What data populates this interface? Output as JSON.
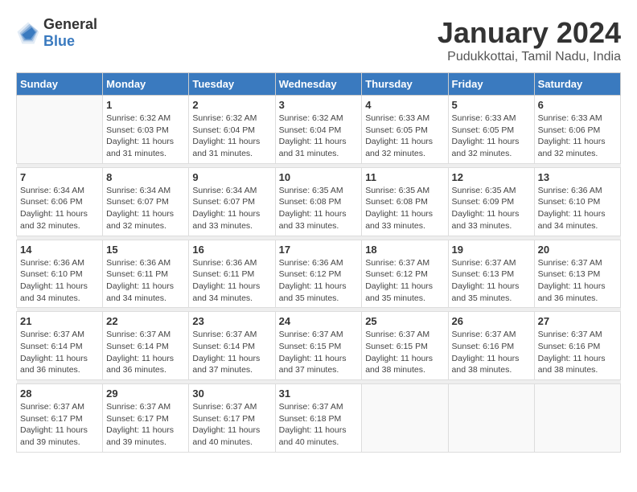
{
  "header": {
    "logo_general": "General",
    "logo_blue": "Blue",
    "title": "January 2024",
    "subtitle": "Pudukkottai, Tamil Nadu, India"
  },
  "weekdays": [
    "Sunday",
    "Monday",
    "Tuesday",
    "Wednesday",
    "Thursday",
    "Friday",
    "Saturday"
  ],
  "weeks": [
    [
      {
        "day": "",
        "info": ""
      },
      {
        "day": "1",
        "info": "Sunrise: 6:32 AM\nSunset: 6:03 PM\nDaylight: 11 hours\nand 31 minutes."
      },
      {
        "day": "2",
        "info": "Sunrise: 6:32 AM\nSunset: 6:04 PM\nDaylight: 11 hours\nand 31 minutes."
      },
      {
        "day": "3",
        "info": "Sunrise: 6:32 AM\nSunset: 6:04 PM\nDaylight: 11 hours\nand 31 minutes."
      },
      {
        "day": "4",
        "info": "Sunrise: 6:33 AM\nSunset: 6:05 PM\nDaylight: 11 hours\nand 32 minutes."
      },
      {
        "day": "5",
        "info": "Sunrise: 6:33 AM\nSunset: 6:05 PM\nDaylight: 11 hours\nand 32 minutes."
      },
      {
        "day": "6",
        "info": "Sunrise: 6:33 AM\nSunset: 6:06 PM\nDaylight: 11 hours\nand 32 minutes."
      }
    ],
    [
      {
        "day": "7",
        "info": "Sunrise: 6:34 AM\nSunset: 6:06 PM\nDaylight: 11 hours\nand 32 minutes."
      },
      {
        "day": "8",
        "info": "Sunrise: 6:34 AM\nSunset: 6:07 PM\nDaylight: 11 hours\nand 32 minutes."
      },
      {
        "day": "9",
        "info": "Sunrise: 6:34 AM\nSunset: 6:07 PM\nDaylight: 11 hours\nand 33 minutes."
      },
      {
        "day": "10",
        "info": "Sunrise: 6:35 AM\nSunset: 6:08 PM\nDaylight: 11 hours\nand 33 minutes."
      },
      {
        "day": "11",
        "info": "Sunrise: 6:35 AM\nSunset: 6:08 PM\nDaylight: 11 hours\nand 33 minutes."
      },
      {
        "day": "12",
        "info": "Sunrise: 6:35 AM\nSunset: 6:09 PM\nDaylight: 11 hours\nand 33 minutes."
      },
      {
        "day": "13",
        "info": "Sunrise: 6:36 AM\nSunset: 6:10 PM\nDaylight: 11 hours\nand 34 minutes."
      }
    ],
    [
      {
        "day": "14",
        "info": "Sunrise: 6:36 AM\nSunset: 6:10 PM\nDaylight: 11 hours\nand 34 minutes."
      },
      {
        "day": "15",
        "info": "Sunrise: 6:36 AM\nSunset: 6:11 PM\nDaylight: 11 hours\nand 34 minutes."
      },
      {
        "day": "16",
        "info": "Sunrise: 6:36 AM\nSunset: 6:11 PM\nDaylight: 11 hours\nand 34 minutes."
      },
      {
        "day": "17",
        "info": "Sunrise: 6:36 AM\nSunset: 6:12 PM\nDaylight: 11 hours\nand 35 minutes."
      },
      {
        "day": "18",
        "info": "Sunrise: 6:37 AM\nSunset: 6:12 PM\nDaylight: 11 hours\nand 35 minutes."
      },
      {
        "day": "19",
        "info": "Sunrise: 6:37 AM\nSunset: 6:13 PM\nDaylight: 11 hours\nand 35 minutes."
      },
      {
        "day": "20",
        "info": "Sunrise: 6:37 AM\nSunset: 6:13 PM\nDaylight: 11 hours\nand 36 minutes."
      }
    ],
    [
      {
        "day": "21",
        "info": "Sunrise: 6:37 AM\nSunset: 6:14 PM\nDaylight: 11 hours\nand 36 minutes."
      },
      {
        "day": "22",
        "info": "Sunrise: 6:37 AM\nSunset: 6:14 PM\nDaylight: 11 hours\nand 36 minutes."
      },
      {
        "day": "23",
        "info": "Sunrise: 6:37 AM\nSunset: 6:14 PM\nDaylight: 11 hours\nand 37 minutes."
      },
      {
        "day": "24",
        "info": "Sunrise: 6:37 AM\nSunset: 6:15 PM\nDaylight: 11 hours\nand 37 minutes."
      },
      {
        "day": "25",
        "info": "Sunrise: 6:37 AM\nSunset: 6:15 PM\nDaylight: 11 hours\nand 38 minutes."
      },
      {
        "day": "26",
        "info": "Sunrise: 6:37 AM\nSunset: 6:16 PM\nDaylight: 11 hours\nand 38 minutes."
      },
      {
        "day": "27",
        "info": "Sunrise: 6:37 AM\nSunset: 6:16 PM\nDaylight: 11 hours\nand 38 minutes."
      }
    ],
    [
      {
        "day": "28",
        "info": "Sunrise: 6:37 AM\nSunset: 6:17 PM\nDaylight: 11 hours\nand 39 minutes."
      },
      {
        "day": "29",
        "info": "Sunrise: 6:37 AM\nSunset: 6:17 PM\nDaylight: 11 hours\nand 39 minutes."
      },
      {
        "day": "30",
        "info": "Sunrise: 6:37 AM\nSunset: 6:17 PM\nDaylight: 11 hours\nand 40 minutes."
      },
      {
        "day": "31",
        "info": "Sunrise: 6:37 AM\nSunset: 6:18 PM\nDaylight: 11 hours\nand 40 minutes."
      },
      {
        "day": "",
        "info": ""
      },
      {
        "day": "",
        "info": ""
      },
      {
        "day": "",
        "info": ""
      }
    ]
  ]
}
